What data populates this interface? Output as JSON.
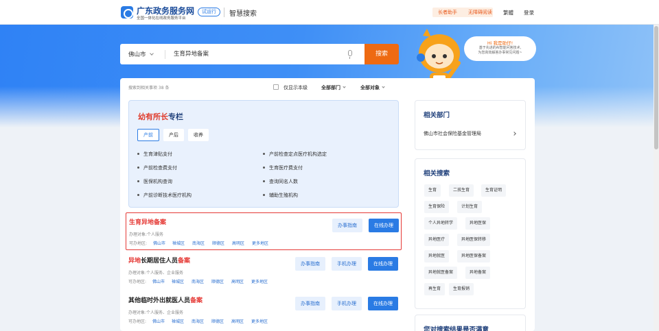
{
  "header": {
    "site_title": "广东政务服务网",
    "site_subtitle": "全国一体化在线政务服务平台",
    "beta_badge": "试运行",
    "smart_search": "智慧搜索",
    "elder_mode": "长者助手",
    "accessible_mode": "无障碍阅读",
    "traditional": "繁體",
    "login": "登录"
  },
  "search": {
    "city": "佛山市",
    "query": "生育异地备案",
    "button": "搜索"
  },
  "assistant": {
    "title": "Hi 我是助仔!",
    "line1": "基于先进的AI智能问答技术,",
    "line2": "为您高效解答办事常见问题~"
  },
  "filters": {
    "result_count": "搜索到相关事项 38 条",
    "only_show": "仅显示本级",
    "department": "全部部门",
    "object": "全部对象"
  },
  "column": {
    "title_red": "幼有所长",
    "title_blue": "专栏",
    "tabs": [
      "产前",
      "产后",
      "收养"
    ],
    "links_left": [
      "生育津贴支付",
      "产前检查费支付",
      "医保机构查询",
      "产前诊断技术医疗机构"
    ],
    "links_right": [
      "产前检查定点医疗机构选定",
      "生育医疗费支付",
      "查询同名人数",
      "辅助生殖机构"
    ]
  },
  "results": [
    {
      "title_hi": "生育异地备案",
      "title_rest": "",
      "title_prefix": "",
      "target": "办理对象:个人服务",
      "regions_label": "可办地区:",
      "regions": [
        "佛山市",
        "禅城区",
        "南海区",
        "顺德区",
        "高明区",
        "更多地区"
      ],
      "btn_guide": "办事指南",
      "btn_online": "在线办理"
    },
    {
      "title_prefix": "异地",
      "title_hi": "",
      "title_mid": "长期居住人员",
      "title_end": "备案",
      "target": "办理对象:个人服务、企业服务",
      "regions_label": "可办地区:",
      "regions": [
        "佛山市",
        "禅城区",
        "南海区",
        "顺德区",
        "高明区",
        "更多地区"
      ],
      "btn_guide": "办事指南",
      "btn_mobile": "手机办理",
      "btn_online": "在线办理"
    },
    {
      "title_mid": "其他临时外出就医人员",
      "title_end": "备案",
      "target": "办理对象:个人服务、企业服务",
      "regions_label": "可办地区:",
      "regions": [
        "佛山市",
        "禅城区",
        "南海区",
        "顺德区",
        "高明区",
        "更多地区"
      ],
      "btn_guide": "办事指南",
      "btn_mobile": "手机办理",
      "btn_online": "在线办理"
    }
  ],
  "related_dept": {
    "title": "相关部门",
    "item": "佛山市社会保险基金管理局"
  },
  "related_search": {
    "title": "相关搜索",
    "tags": [
      "生育",
      "二孩生育",
      "生育证明",
      "生育保险",
      "计划生育",
      "个人异地转学",
      "异地医保",
      "异地医疗",
      "异地医保转移",
      "异地就医",
      "异地医保备案",
      "异地就医备案",
      "异地备案",
      "再生育",
      "生育报销"
    ]
  },
  "feedback": {
    "title": "您对搜索结果是否满意"
  }
}
